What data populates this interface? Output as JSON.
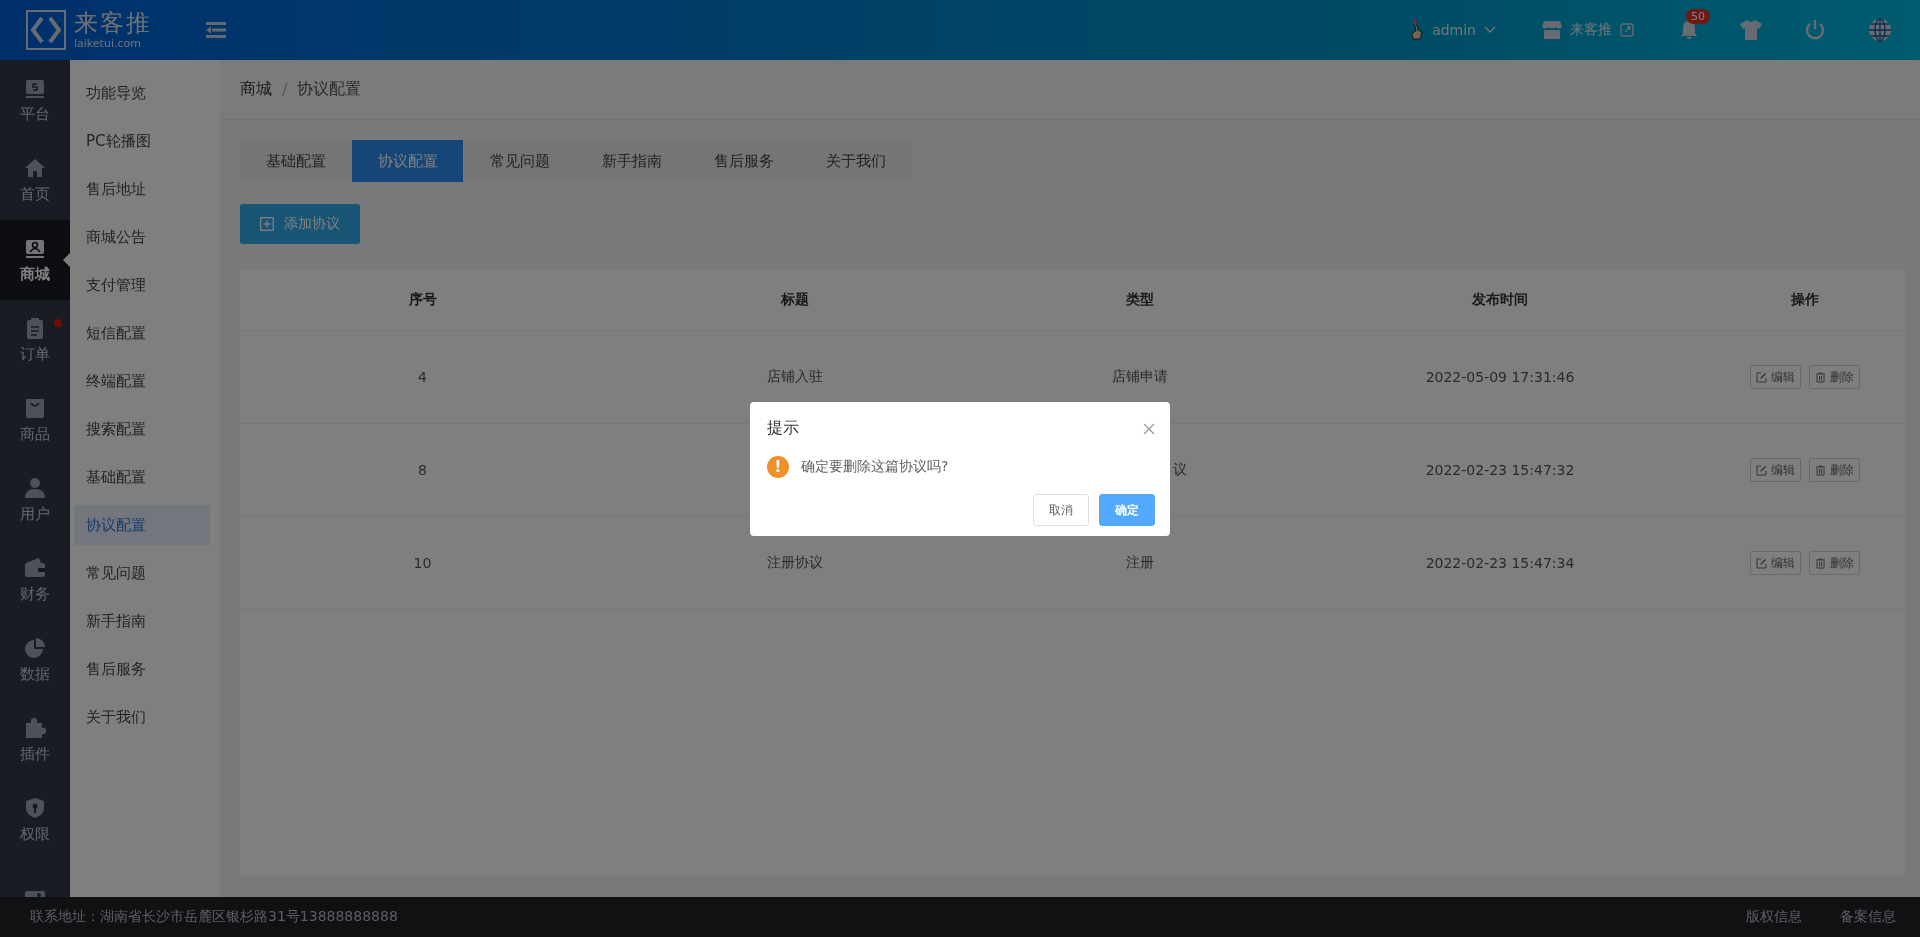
{
  "header": {
    "logo_text": "来客推",
    "logo_sub": "laiketui.com",
    "user": "admin",
    "shop": "来客推",
    "notifications": "50"
  },
  "rail": [
    {
      "label": "平台",
      "selected": false,
      "dot": false
    },
    {
      "label": "首页",
      "selected": false,
      "dot": false
    },
    {
      "label": "商城",
      "selected": true,
      "dot": false
    },
    {
      "label": "订单",
      "selected": false,
      "dot": true
    },
    {
      "label": "商品",
      "selected": false,
      "dot": false
    },
    {
      "label": "用户",
      "selected": false,
      "dot": false
    },
    {
      "label": "财务",
      "selected": false,
      "dot": false
    },
    {
      "label": "数据",
      "selected": false,
      "dot": false
    },
    {
      "label": "插件",
      "selected": false,
      "dot": false
    },
    {
      "label": "权限",
      "selected": false,
      "dot": false
    },
    {
      "selected": false,
      "dot": false
    }
  ],
  "submenu": [
    {
      "label": "功能导览",
      "selected": false
    },
    {
      "label": "PC轮播图",
      "selected": false
    },
    {
      "label": "售后地址",
      "selected": false
    },
    {
      "label": "商城公告",
      "selected": false
    },
    {
      "label": "支付管理",
      "selected": false
    },
    {
      "label": "短信配置",
      "selected": false
    },
    {
      "label": "终端配置",
      "selected": false
    },
    {
      "label": "搜索配置",
      "selected": false
    },
    {
      "label": "基础配置",
      "selected": false
    },
    {
      "label": "协议配置",
      "selected": true
    },
    {
      "label": "常见问题",
      "selected": false
    },
    {
      "label": "新手指南",
      "selected": false
    },
    {
      "label": "售后服务",
      "selected": false
    },
    {
      "label": "关于我们",
      "selected": false
    }
  ],
  "breadcrumb": [
    "商城",
    "协议配置"
  ],
  "breadcrumb_separator": "/",
  "tabs": [
    {
      "label": "基础配置",
      "selected": false
    },
    {
      "label": "协议配置",
      "selected": true
    },
    {
      "label": "常见问题",
      "selected": false
    },
    {
      "label": "新手指南",
      "selected": false
    },
    {
      "label": "售后服务",
      "selected": false
    },
    {
      "label": "关于我们",
      "selected": false
    }
  ],
  "add_button": "添加协议",
  "table": {
    "columns": [
      "序号",
      "标题",
      "类型",
      "发布时间",
      "操作"
    ],
    "rows": [
      {
        "kind": "full",
        "id": "4",
        "title": "店铺入驻",
        "type": "店铺申请",
        "time": "2022-05-09 17:31:46",
        "actions": [
          "编辑",
          "删除"
        ]
      },
      {
        "kind": "covered",
        "id": "8",
        "type": "议",
        "time": "2022-02-23 15:47:32",
        "actions": [
          "编辑",
          "删除"
        ]
      },
      {
        "kind": "full",
        "id": "10",
        "title": "注册协议",
        "type": "注册",
        "time": "2022-02-23 15:47:34",
        "actions": [
          "编辑",
          "删除"
        ]
      }
    ]
  },
  "footer": {
    "address": "联系地址：湖南省长沙市岳麓区银杉路31号13888888888",
    "links": [
      "版权信息",
      "备案信息"
    ]
  },
  "dialog": {
    "title": "提示",
    "message": "确定要删除这篇协议吗?",
    "icon": "!",
    "buttons": [
      "取消",
      "确定"
    ]
  }
}
